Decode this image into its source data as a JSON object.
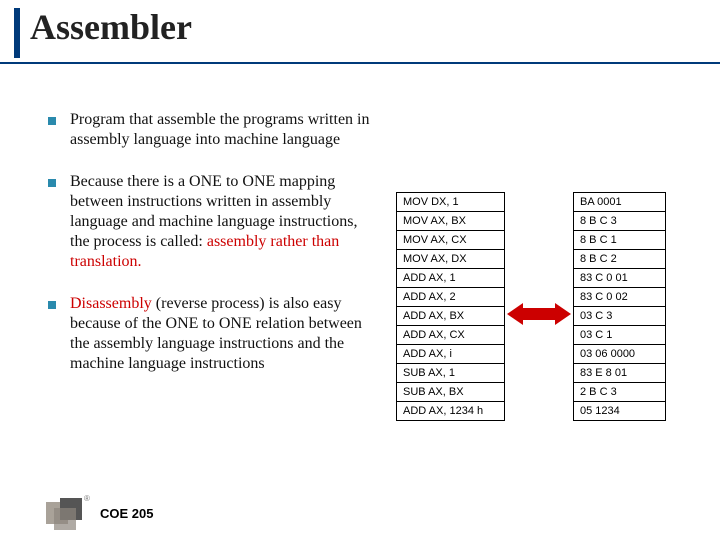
{
  "title": "Assembler",
  "bullets": {
    "b1": "Program that assemble the programs written in assembly language into machine language",
    "b2_pre": "Because there is a ONE to ONE mapping between instructions written in assembly language and machine language instructions, the process is called: ",
    "b2_red": "assembly rather than translation.",
    "b3_red": "Disassembly",
    "b3_post": " (reverse process) is also easy because of the ONE to ONE relation between the assembly language instructions and the machine language instructions"
  },
  "table_left": [
    "MOV DX, 1",
    "MOV AX, BX",
    "MOV AX, CX",
    "MOV AX, DX",
    "ADD AX, 1",
    "ADD AX, 2",
    "ADD AX, BX",
    "ADD AX, CX",
    "ADD AX, i",
    "SUB AX, 1",
    "SUB AX, BX",
    "ADD AX, 1234 h"
  ],
  "table_right": [
    "BA 0001",
    "8 B C 3",
    "8 B C 1",
    "8 B C 2",
    "83 C 0 01",
    "83 C 0 02",
    "03 C 3",
    "03 C 1",
    "03 06 0000",
    "83 E 8 01",
    "2 B C 3",
    "05 1234"
  ],
  "footer": {
    "course": "COE 205",
    "reg": "®"
  }
}
